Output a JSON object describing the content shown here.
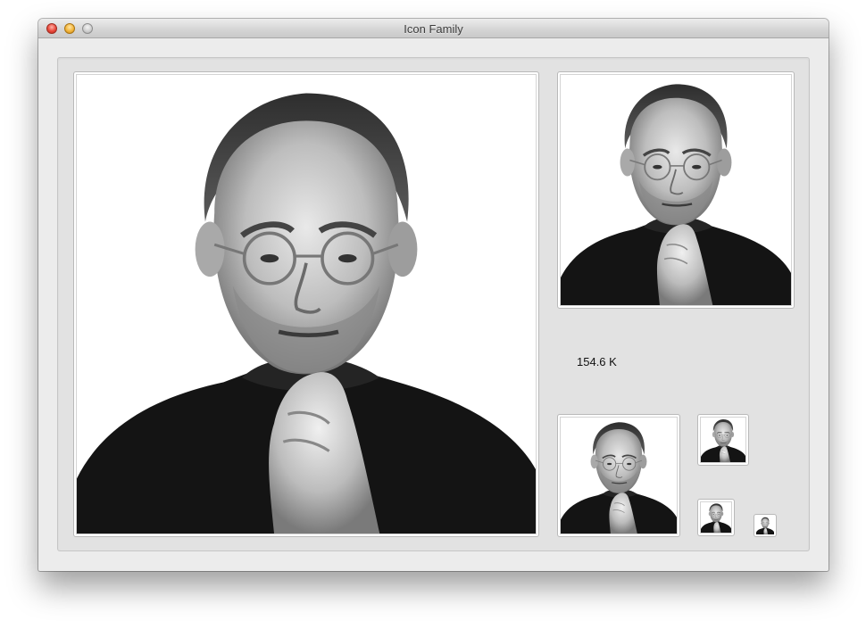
{
  "window": {
    "title": "Icon Family"
  },
  "wells": {
    "large": {
      "name": "icon-512"
    },
    "medium": {
      "name": "icon-256"
    },
    "small": {
      "name": "icon-128"
    },
    "tiny": {
      "name": "icon-48"
    },
    "micro": {
      "name": "icon-32"
    },
    "nano": {
      "name": "icon-16"
    }
  },
  "info": {
    "file_size": "154.6 K"
  },
  "icons": {
    "close": "close-icon",
    "minimize": "minimize-icon",
    "zoom": "zoom-icon"
  },
  "colors": {
    "window_bg": "#ececec",
    "content_bg": "#e2e2e2",
    "close": "#e9473a",
    "minimize": "#f3b53b",
    "zoom": "#cfcfcf"
  }
}
